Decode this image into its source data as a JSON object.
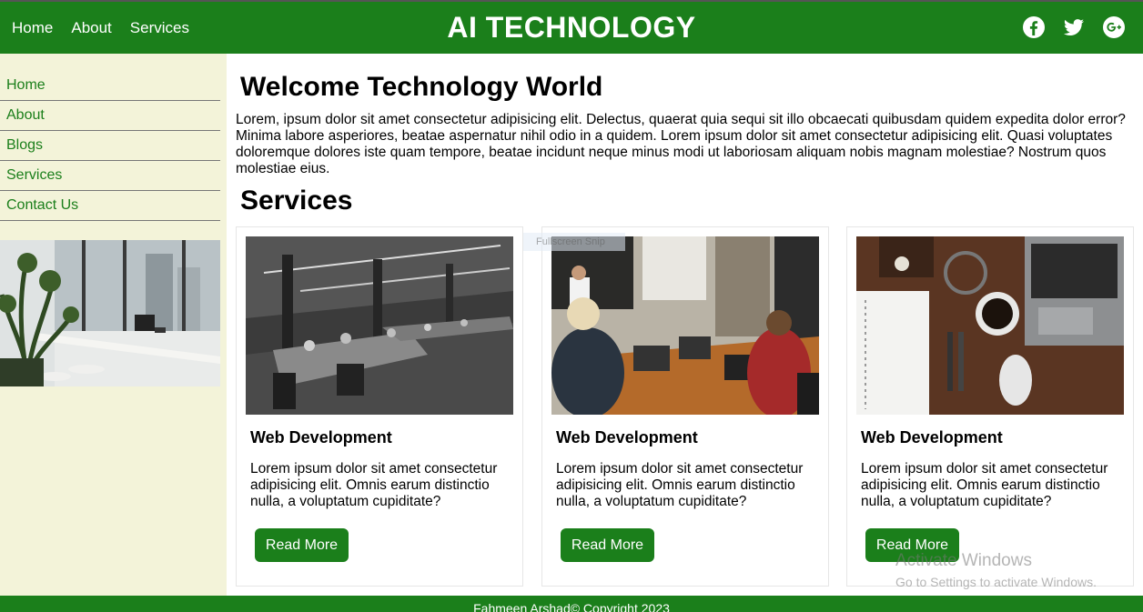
{
  "header": {
    "nav": [
      "Home",
      "About",
      "Services"
    ],
    "brand": "AI TECHNOLOGY",
    "social": [
      "facebook-icon",
      "twitter-icon",
      "google-plus-icon"
    ]
  },
  "sidebar": {
    "menu": [
      "Home",
      "About",
      "Blogs",
      "Services",
      "Contact Us"
    ]
  },
  "main": {
    "title": "Welcome Technology World",
    "intro": "Lorem, ipsum dolor sit amet consectetur adipisicing elit. Delectus, quaerat quia sequi sit illo obcaecati quibusdam quidem expedita dolor error? Minima labore asperiores, beatae aspernatur nihil odio in a quidem. Lorem ipsum dolor sit amet consectetur adipisicing elit. Quasi voluptates doloremque dolores iste quam tempore, beatae incidunt neque minus modi ut laboriosam aliquam nobis magnam molestiae? Nostrum quos molestiae eius.",
    "services_title": "Services",
    "cards": [
      {
        "title": "Web Development",
        "text": "Lorem ipsum dolor sit amet consectetur adipisicing elit. Omnis earum distinctio nulla, a voluptatum cupiditate?",
        "button": "Read More"
      },
      {
        "title": "Web Development",
        "text": "Lorem ipsum dolor sit amet consectetur adipisicing elit. Omnis earum distinctio nulla, a voluptatum cupiditate?",
        "button": "Read More"
      },
      {
        "title": "Web Development",
        "text": "Lorem ipsum dolor sit amet consectetur adipisicing elit. Omnis earum distinctio nulla, a voluptatum cupiditate?",
        "button": "Read More"
      }
    ]
  },
  "footer": {
    "text": "Fahmeen Arshad© Copyright 2023"
  },
  "overlay": {
    "tooltip": "Fullscreen Snip",
    "watermark_title": "Activate Windows",
    "watermark_sub": "Go to Settings to activate Windows."
  },
  "colors": {
    "primary": "#1b7f1b",
    "sidebar_bg": "#f3f3d9"
  }
}
